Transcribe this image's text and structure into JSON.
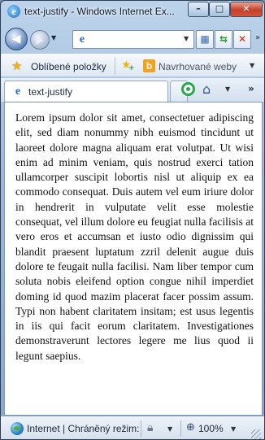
{
  "window": {
    "title": "text-justify - Windows Internet Ex..."
  },
  "nav": {
    "address_value": ""
  },
  "favorites": {
    "label": "Oblíbené položky",
    "suggested_label": "Navrhované weby"
  },
  "tab": {
    "label": "text-justify"
  },
  "content": {
    "paragraph": "Lorem ipsum dolor sit amet, consectetuer adipiscing elit, sed diam nonummy nibh euismod tincidunt ut laoreet dolore magna aliquam erat volutpat. Ut wisi enim ad minim veniam, quis nostrud exerci tation ullamcorper suscipit lobortis nisl ut aliquip ex ea commodo consequat. Duis autem vel eum iriure dolor in hendrerit in vulputate velit esse molestie consequat, vel illum dolore eu feugiat nulla facilisis at vero eros et accumsan et iusto odio dignissim qui blandit praesent luptatum zzril delenit augue duis dolore te feugait nulla facilisi. Nam liber tempor cum soluta nobis eleifend option congue nihil imperdiet doming id quod mazim placerat facer possim assum. Typi non habent claritatem insitam; est usus legentis in iis qui facit eorum claritatem. Investigationes demonstraverunt lectores legere me lius quod ii legunt saepius."
  },
  "status": {
    "text": "Internet | Chráněný režim:",
    "zoom": "100%"
  },
  "colors": {
    "frame": "#88a8cd",
    "close_button": "#c3402a"
  },
  "icons": [
    "ie-icon",
    "back-arrow-icon",
    "forward-arrow-icon",
    "compatibility-icon",
    "refresh-icon",
    "stop-icon",
    "favorites-star-icon",
    "add-favorites-icon",
    "bing-icon",
    "feed-icon",
    "home-icon",
    "globe-icon",
    "lock-icon",
    "zoom-icon"
  ]
}
